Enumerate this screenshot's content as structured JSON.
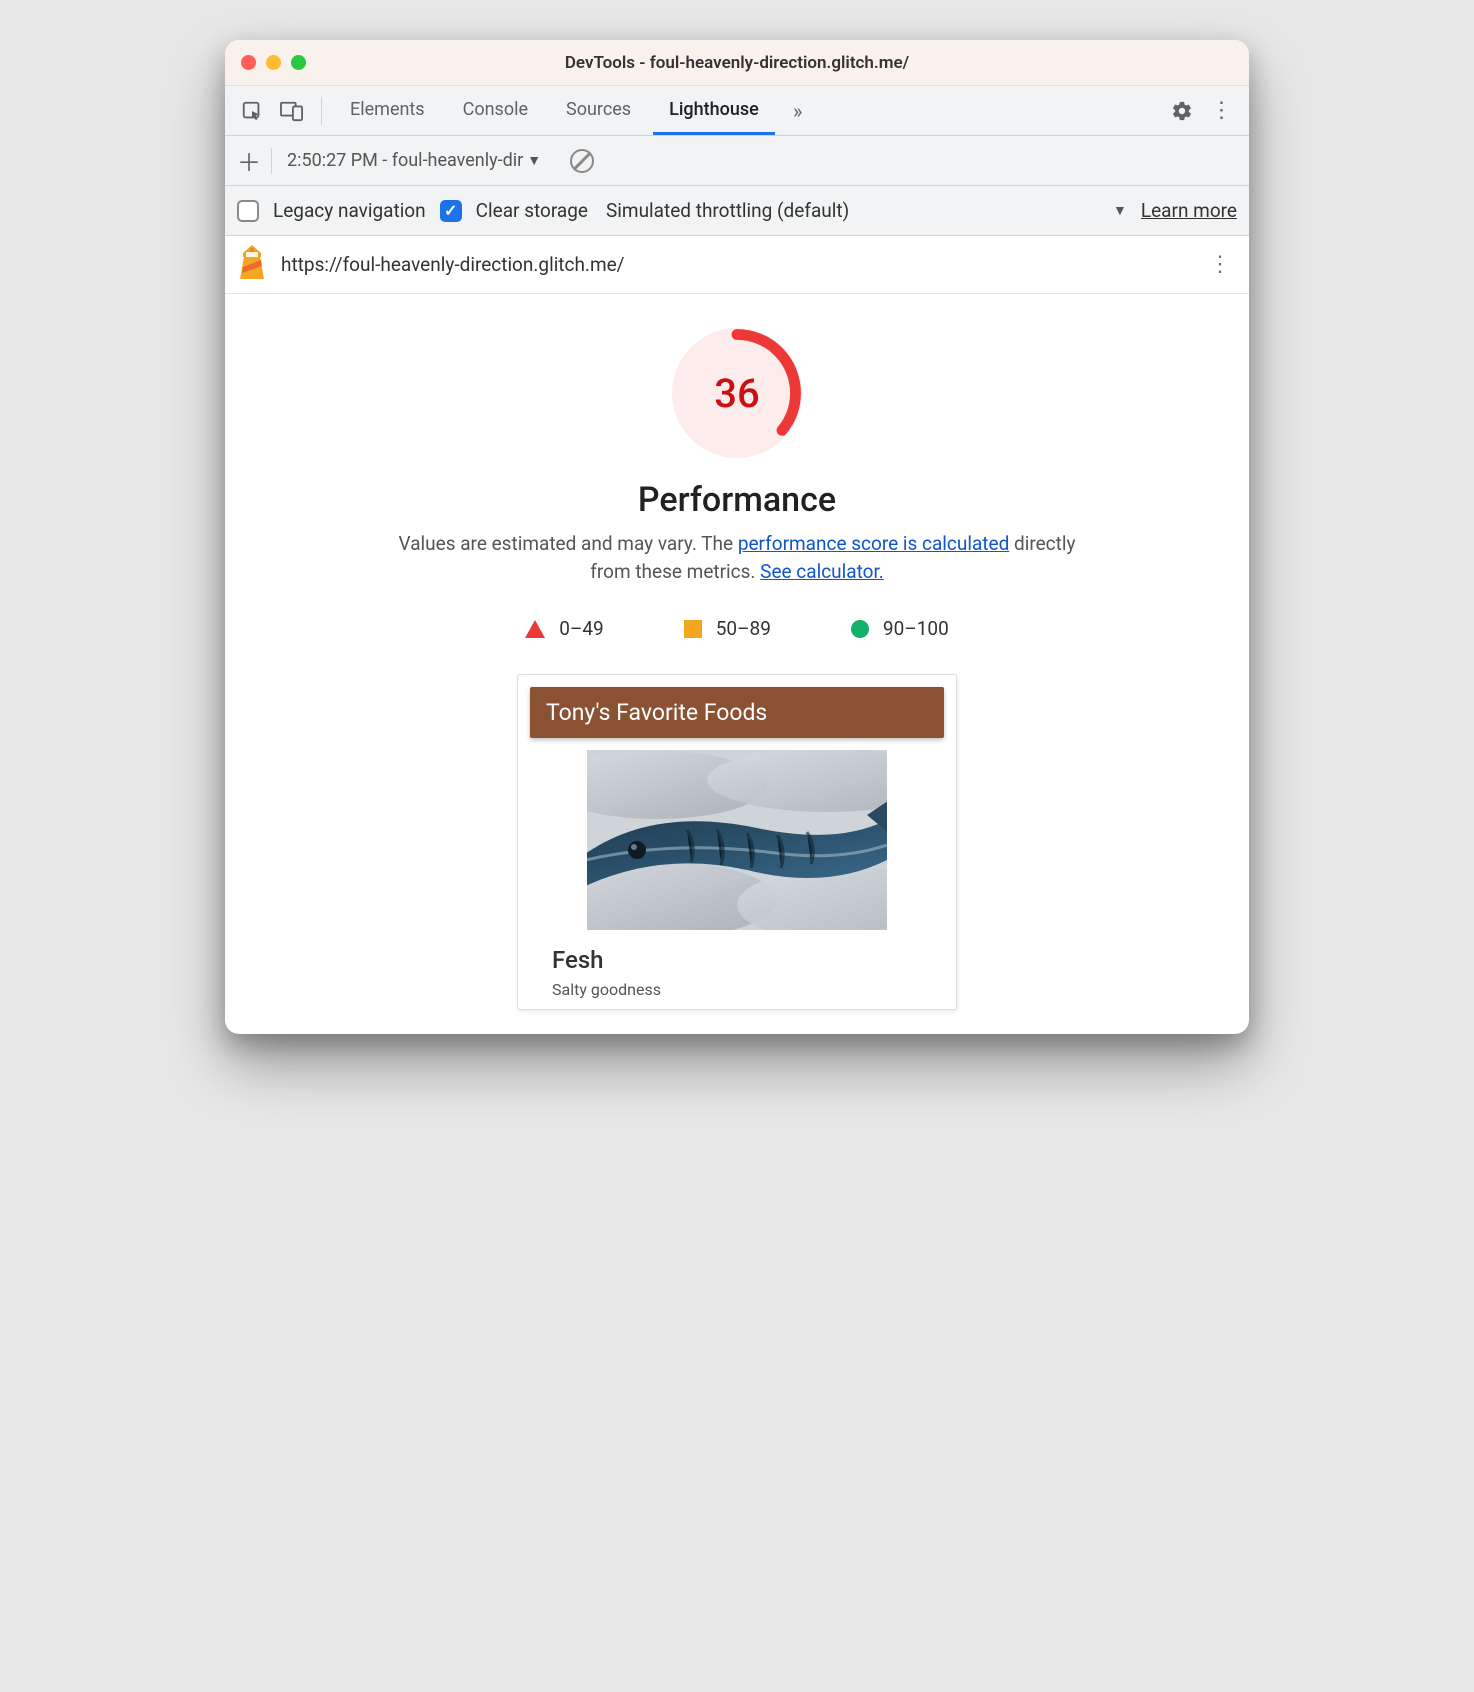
{
  "window": {
    "title": "DevTools - foul-heavenly-direction.glitch.me/"
  },
  "tabs": {
    "elements": "Elements",
    "console": "Console",
    "sources": "Sources",
    "lighthouse": "Lighthouse"
  },
  "subbar": {
    "report_label": "2:50:27 PM - foul-heavenly-dir"
  },
  "settings": {
    "legacy_label": "Legacy navigation",
    "legacy_checked": false,
    "clear_label": "Clear storage",
    "clear_checked": true,
    "throttling_label": "Simulated throttling (default)",
    "learn_more": "Learn more"
  },
  "url": "https://foul-heavenly-direction.glitch.me/",
  "report": {
    "score": "36",
    "score_percent": 36,
    "category": "Performance",
    "desc_prefix": "Values are estimated and may vary. The ",
    "desc_link1": "performance score is calculated",
    "desc_mid": " directly from these metrics. ",
    "desc_link2": "See calculator.",
    "legend": {
      "fail": "0–49",
      "avg": "50–89",
      "pass": "90–100"
    },
    "screenshot": {
      "header": "Tony's Favorite Foods",
      "item_title": "Fesh",
      "item_sub": "Salty goodness"
    }
  },
  "colors": {
    "fail": "#ec3836",
    "avg": "#f4a522",
    "pass": "#13b26a"
  }
}
